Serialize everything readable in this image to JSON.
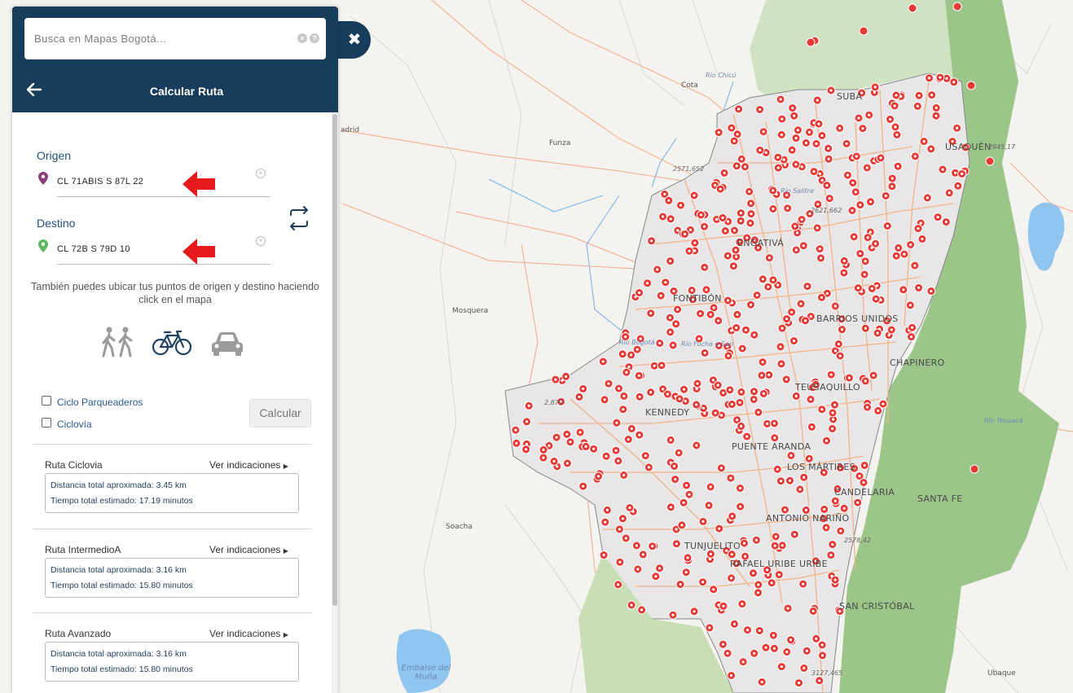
{
  "search": {
    "placeholder": "Busca en Mapas Bogotá..."
  },
  "panel": {
    "title": "Calcular Ruta"
  },
  "origin": {
    "label": "Origen",
    "value": "CL 71ABIS S 87L 22"
  },
  "destination": {
    "label": "Destino",
    "value": "CL 72B S 79D 10"
  },
  "hint_text": "También puedes ubicar tus puntos de origen y destino haciendo click en el mapa",
  "modes": [
    {
      "icon": "walking-icon",
      "selected": false
    },
    {
      "icon": "bicycle-icon",
      "selected": true
    },
    {
      "icon": "car-icon",
      "selected": false
    }
  ],
  "options": {
    "ciclo_parqueaderos": "Ciclo Parqueaderos",
    "ciclovia": "Ciclovía",
    "checked": [
      false,
      false
    ]
  },
  "calculate_label": "Calcular",
  "routes": [
    {
      "name": "Ruta Ciclovia",
      "link": "Ver indicaciones",
      "distance": "Distancia total aproximada: 3.45 km",
      "time": "Tiempo total estimado: 17.19 minutos"
    },
    {
      "name": "Ruta IntermedioA",
      "link": "Ver indicaciones",
      "distance": "Distancia total aproximada: 3.16 km",
      "time": "Tiempo total estimado: 15.80 minutos"
    },
    {
      "name": "Ruta Avanzado",
      "link": "Ver indicaciones",
      "distance": "Distancia total aproximada: 3.16 km",
      "time": "Tiempo total estimado: 15.80 minutos"
    }
  ],
  "map": {
    "colors": {
      "urban": "#e9e6e6",
      "green": "#9cc58a",
      "water": "#8fc5ef",
      "roads": "#f0b487",
      "marker": "#e53935"
    },
    "labels": {
      "cota": "Cota",
      "rio_chicu": "Río Chicú",
      "suba": "SUBA",
      "funza": "Funza",
      "usaquen": "USAQUÉN",
      "rio_sotavento": "Río Salitre",
      "engativa": "ENGATIVÁ",
      "mosquera": "Mosquera",
      "fontibon": "FONTIBÓN",
      "rio_bogota": "Río Bogotá",
      "rio_fucha": "Río Fucha o San",
      "barrios_unidos": "BARRIOS UNIDOS",
      "chapinero": "CHAPINERO",
      "teusaquillo": "TEUSAQUILLO",
      "kennedy": "KENNEDY",
      "rio_teusaca": "Río Teusacá",
      "puente_aranda": "PUENTE ARANDA",
      "los_martires": "LOS MÁRTIRES",
      "santa_fe": "SANTA FE",
      "candelaria": "CANDELARIA",
      "antonio_narino": "ANTONIO NARIÑO",
      "soacha": "Soacha",
      "tunjuelito": "TUNJUELITO",
      "rafael_uribe": "RAFAEL URIBE URIBE",
      "san_cristobal": "SAN CRISTÓBAL",
      "embalse": "Embalse del Muña",
      "ubaque": "Ubaque",
      "madrid": "adrid"
    },
    "elevations": [
      "2571,652",
      "2621,662",
      "2945,17",
      "2,879",
      "2578,42",
      "3127,465"
    ]
  }
}
